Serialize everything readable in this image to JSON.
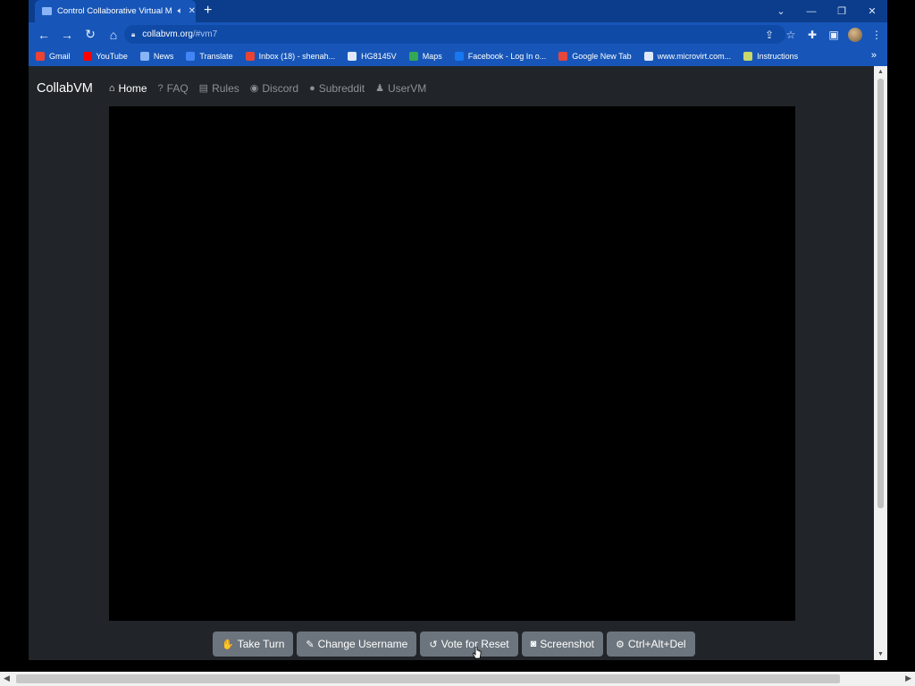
{
  "browser": {
    "tab": {
      "title": "Control Collaborative Virtual Machines!",
      "audio_icon": "speaker-icon",
      "close_icon": "close-icon"
    },
    "new_tab": "+",
    "address": {
      "host": "collabvm.org",
      "path": "/#vm7"
    },
    "bookmarks": [
      {
        "label": "Gmail",
        "color": "#ea4335"
      },
      {
        "label": "YouTube",
        "color": "#ff0000"
      },
      {
        "label": "News",
        "color": "#8ab4f8"
      },
      {
        "label": "Translate",
        "color": "#4285f4"
      },
      {
        "label": "Inbox (18) - shenah...",
        "color": "#ea4335"
      },
      {
        "label": "HG8145V",
        "color": "#dfe8f8"
      },
      {
        "label": "Maps",
        "color": "#34a853"
      },
      {
        "label": "Facebook - Log In o...",
        "color": "#1877f2"
      },
      {
        "label": "Google New Tab",
        "color": "#e8453c"
      },
      {
        "label": "www.microvirt.com...",
        "color": "#dfe8f8"
      },
      {
        "label": "Instructions",
        "color": "#c8d86a"
      }
    ],
    "bookmarks_more": "»"
  },
  "site": {
    "brand": "CollabVM",
    "nav": [
      {
        "label": "Home",
        "icon": "home-icon",
        "glyph": "⌂",
        "active": true
      },
      {
        "label": "FAQ",
        "icon": "question-icon",
        "glyph": "?",
        "active": false
      },
      {
        "label": "Rules",
        "icon": "clipboard-icon",
        "glyph": "▤",
        "active": false
      },
      {
        "label": "Discord",
        "icon": "discord-icon",
        "glyph": "◉",
        "active": false
      },
      {
        "label": "Subreddit",
        "icon": "reddit-icon",
        "glyph": "●",
        "active": false
      },
      {
        "label": "UserVM",
        "icon": "user-icon",
        "glyph": "♟",
        "active": false
      }
    ],
    "buttons": [
      {
        "label": "Take Turn",
        "icon": "hand-icon",
        "glyph": "✋"
      },
      {
        "label": "Change Username",
        "icon": "user-edit-icon",
        "glyph": "✎"
      },
      {
        "label": "Vote for Reset",
        "icon": "undo-icon",
        "glyph": "↺"
      },
      {
        "label": "Screenshot",
        "icon": "camera-icon",
        "glyph": "◙"
      },
      {
        "label": "Ctrl+Alt+Del",
        "icon": "gear-icon",
        "glyph": "⚙"
      }
    ]
  }
}
